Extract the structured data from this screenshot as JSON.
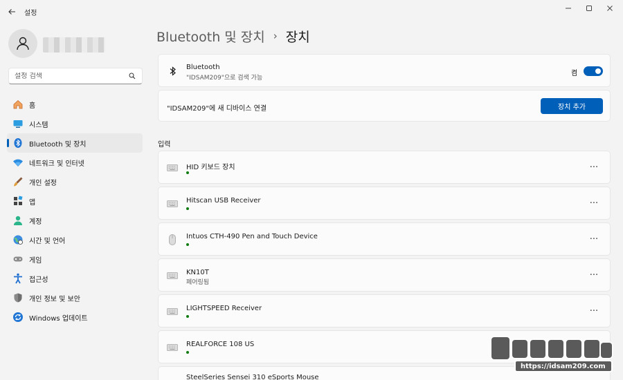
{
  "window": {
    "title": "설정",
    "controls": {
      "minimize": "—",
      "maximize": "☐",
      "close": "✕"
    }
  },
  "sidebar": {
    "search_placeholder": "설정 검색",
    "items": [
      {
        "label": "홈",
        "icon": "home-icon",
        "active": false
      },
      {
        "label": "시스템",
        "icon": "system-icon",
        "active": false
      },
      {
        "label": "Bluetooth 및 장치",
        "icon": "bluetooth-icon",
        "active": true
      },
      {
        "label": "네트워크 및 인터넷",
        "icon": "network-icon",
        "active": false
      },
      {
        "label": "개인 설정",
        "icon": "personalization-icon",
        "active": false
      },
      {
        "label": "앱",
        "icon": "apps-icon",
        "active": false
      },
      {
        "label": "계정",
        "icon": "account-icon",
        "active": false
      },
      {
        "label": "시간 및 언어",
        "icon": "time-language-icon",
        "active": false
      },
      {
        "label": "게임",
        "icon": "gaming-icon",
        "active": false
      },
      {
        "label": "접근성",
        "icon": "accessibility-icon",
        "active": false
      },
      {
        "label": "개인 정보 및 보안",
        "icon": "privacy-shield-icon",
        "active": false
      },
      {
        "label": "Windows 업데이트",
        "icon": "windows-update-icon",
        "active": false
      }
    ]
  },
  "breadcrumb": {
    "parent": "Bluetooth 및 장치",
    "separator": "›",
    "current": "장치"
  },
  "bluetooth_card": {
    "title": "Bluetooth",
    "subtitle": "\"IDSAM209\"으로 검색 가능",
    "state_label": "켬",
    "enabled": true
  },
  "connect_card": {
    "text": "\"IDSAM209\"에 새 디바이스 연결",
    "button_label": "장치 추가"
  },
  "input_section": {
    "title": "입력",
    "devices": [
      {
        "name": "HID 키보드 장치",
        "icon": "keyboard-icon",
        "status": "",
        "connected": true
      },
      {
        "name": "Hitscan USB Receiver",
        "icon": "keyboard-icon",
        "status": "",
        "connected": true
      },
      {
        "name": "Intuos CTH-490 Pen and Touch Device",
        "icon": "mouse-icon",
        "status": "",
        "connected": true
      },
      {
        "name": "KN10T",
        "icon": "keyboard-icon",
        "status": "페어링됨",
        "connected": false
      },
      {
        "name": "LIGHTSPEED Receiver",
        "icon": "keyboard-icon",
        "status": "",
        "connected": true
      },
      {
        "name": "REALFORCE 108 US",
        "icon": "keyboard-icon",
        "status": "",
        "connected": true
      },
      {
        "name": "SteelSeries Sensei 310 eSports Mouse",
        "icon": "keyboard-icon",
        "status": "",
        "connected": true
      }
    ],
    "more_label": "···"
  },
  "watermark": {
    "text": "https://idsam209.com"
  },
  "colors": {
    "accent": "#005fb8",
    "connected_dot": "#0f7b0f",
    "background": "#f3f3f3",
    "card": "#fbfbfb"
  }
}
